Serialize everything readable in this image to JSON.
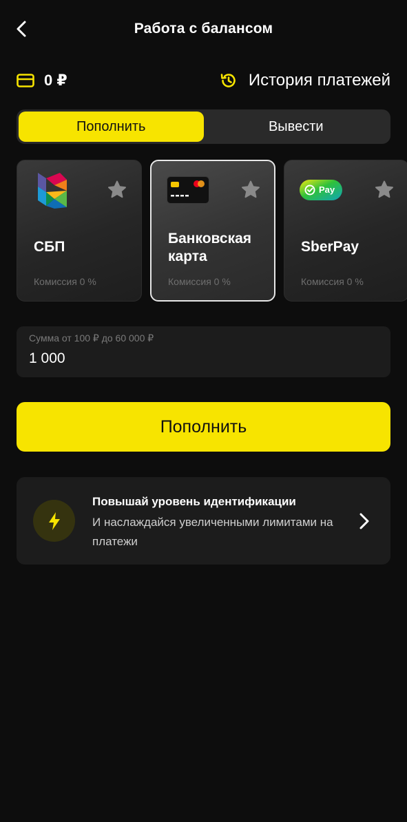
{
  "header": {
    "title": "Работа с балансом",
    "back_icon": "chevron-left-icon"
  },
  "balance": {
    "icon": "card-icon",
    "amount": "0 ₽"
  },
  "history": {
    "icon": "history-icon",
    "label": "История платежей"
  },
  "tabs": [
    {
      "label": "Пополнить",
      "active": true
    },
    {
      "label": "Вывести",
      "active": false
    }
  ],
  "methods": [
    {
      "title": "СБП",
      "fee": "Комиссия 0 %",
      "icon": "sbp-logo-icon",
      "selected": false
    },
    {
      "title": "Банковская карта",
      "fee": "Комиссия 0 %",
      "icon": "bank-card-icon",
      "selected": true
    },
    {
      "title": "SberPay",
      "fee": "Комиссия 0 %",
      "icon": "sberpay-logo-icon",
      "selected": false
    }
  ],
  "sberpay_badge": "Pay",
  "amount": {
    "hint": "Сумма от 100 ₽ до 60 000 ₽",
    "value": "1 000"
  },
  "submit": {
    "label": "Пополнить"
  },
  "banner": {
    "title": "Повышай уровень идентификации",
    "text": "И наслаждайся увеличенными лимитами на платежи",
    "icon": "lightning-icon",
    "chevron": "chevron-right-icon"
  },
  "colors": {
    "background": "#0d0d0d",
    "accent": "#f7e400",
    "surface": "#1c1c1c"
  }
}
